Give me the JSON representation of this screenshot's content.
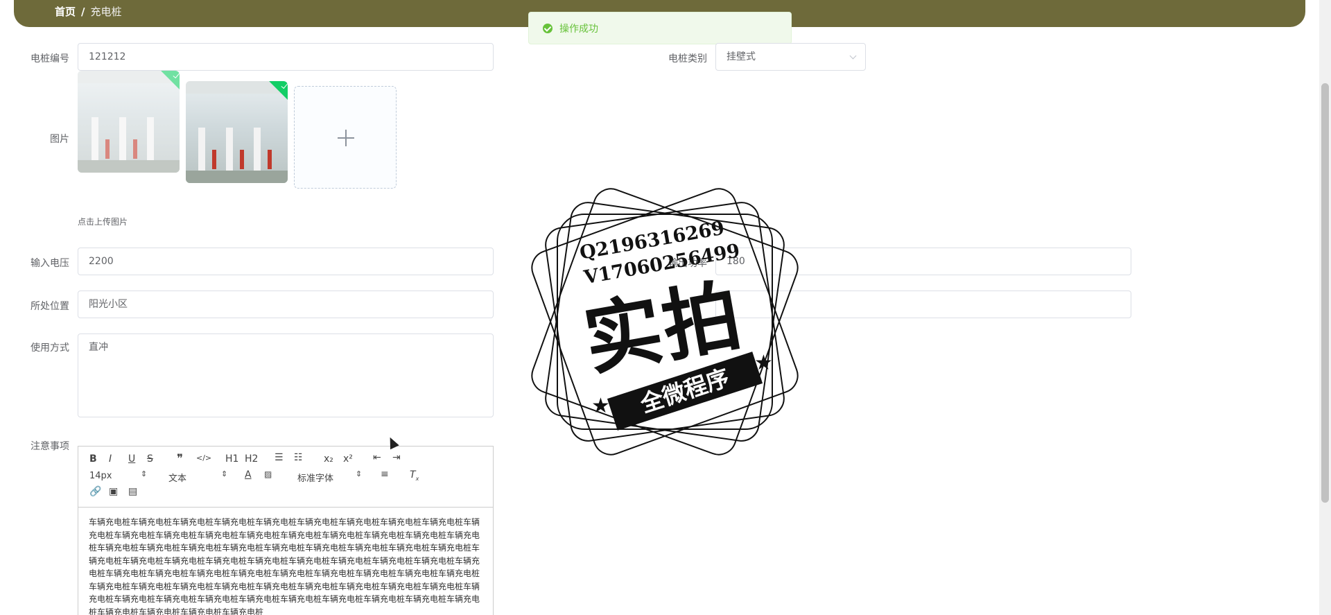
{
  "breadcrumb": {
    "home": "首页",
    "separator": "/",
    "current": "充电桩"
  },
  "toast": {
    "message": "操作成功"
  },
  "form": {
    "pile_number": {
      "label": "电桩编号",
      "value": "121212"
    },
    "pile_type": {
      "label": "电桩类别",
      "value": "挂壁式"
    },
    "images": {
      "label": "图片",
      "hint": "点击上传图片"
    },
    "input_voltage": {
      "label": "输入电压",
      "value": "2200"
    },
    "output_power": {
      "label": "输出功率",
      "value": "180"
    },
    "location": {
      "label": "所处位置",
      "value": "阳光小区"
    },
    "usage": {
      "label": "使用方式",
      "value": "直冲"
    },
    "notes": {
      "label": "注意事项",
      "toolbar": {
        "font_size": "14px",
        "text_style": "文本",
        "font_family": "标准字体",
        "bold": "B",
        "italic": "I",
        "underline": "U",
        "strike": "S",
        "quote": "❞",
        "code": "</>",
        "h1": "H1",
        "h2": "H2",
        "ordered_list": "☰",
        "bullet_list": "☷",
        "subscript": "x₂",
        "superscript": "x²",
        "outdent": "⇤",
        "indent": "⇥"
      },
      "content": "车辆充电桩车辆充电桩车辆充电桩车辆充电桩车辆充电桩车辆充电桩车辆充电桩车辆充电桩车辆充电桩车辆充电桩车辆充电桩车辆充电桩车辆充电桩车辆充电桩车辆充电桩车辆充电桩车辆充电桩车辆充电桩车辆充电桩车辆充电桩车辆充电桩车辆充电桩车辆充电桩车辆充电桩车辆充电桩车辆充电桩车辆充电桩车辆充电桩车辆充电桩车辆充电桩车辆充电桩车辆充电桩车辆充电桩车辆充电桩车辆充电桩车辆充电桩车辆充电桩车辆充电桩车辆充电桩车辆充电桩车辆充电桩车辆充电桩车辆充电桩车辆充电桩车辆充电桩车辆充电桩车辆充电桩车辆充电桩车辆充电桩车辆充电桩车辆充电桩车辆充电桩车辆充电桩车辆充电桩车辆充电桩车辆充电桩车辆充电桩车辆充电桩车辆充电桩车辆充电桩车辆充电桩车辆充电桩车辆充电桩车辆充电桩车辆充电桩车辆充电桩车辆充电桩车辆充电桩车辆充电桩车辆充电桩"
    }
  },
  "watermark": {
    "qq": "Q2196316269",
    "vx": "V17060256499",
    "big": "实拍",
    "ribbon": "全微程序"
  },
  "colors": {
    "header": "#6e6a3a",
    "success": "#67c23a",
    "border": "#dcdfe6"
  }
}
